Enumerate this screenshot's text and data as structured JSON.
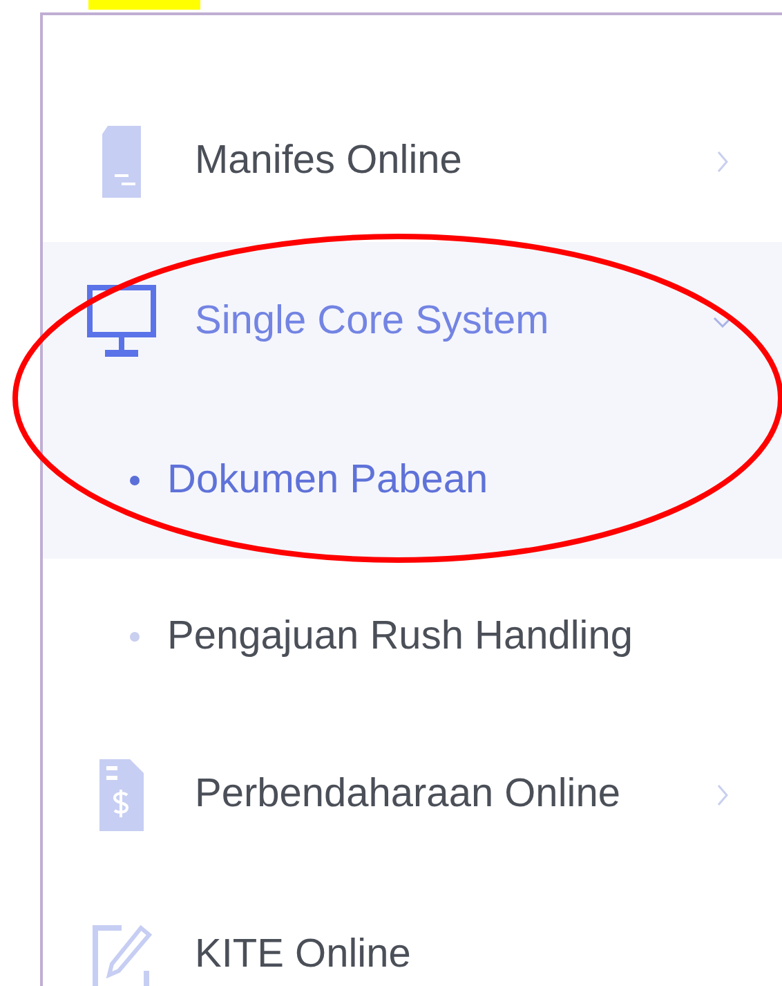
{
  "menu": [
    {
      "label": "Manifes Online",
      "expanded": false
    },
    {
      "label": "Single Core System",
      "expanded": true,
      "children": [
        {
          "label": "Dokumen Pabean",
          "selected": true
        },
        {
          "label": "Pengajuan Rush Handling",
          "selected": false
        }
      ]
    },
    {
      "label": "Perbendaharaan Online",
      "expanded": false
    },
    {
      "label": "KITE Online"
    }
  ]
}
